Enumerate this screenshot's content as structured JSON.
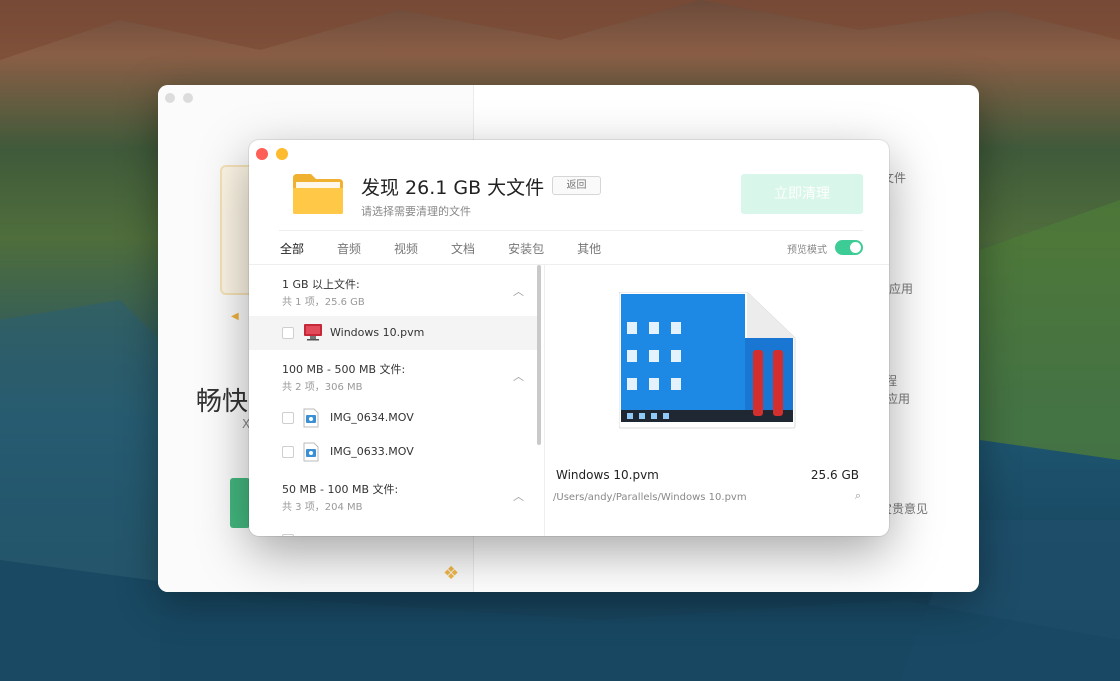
{
  "background_window": {
    "title": "畅快",
    "subtitle": "X",
    "right_texts": [
      "文件",
      "应用",
      "程",
      "应用",
      "宝贵意见"
    ]
  },
  "dialog": {
    "title": "发现 26.1 GB 大文件",
    "subtitle": "请选择需要清理的文件",
    "back_label": "返回",
    "clean_label": "立即清理",
    "tabs": [
      {
        "label": "全部",
        "active": true
      },
      {
        "label": "音频",
        "active": false
      },
      {
        "label": "视频",
        "active": false
      },
      {
        "label": "文档",
        "active": false
      },
      {
        "label": "安装包",
        "active": false
      },
      {
        "label": "其他",
        "active": false
      }
    ],
    "preview_mode_label": "预览模式",
    "preview_mode_on": true,
    "groups": [
      {
        "heading": "1 GB 以上文件:",
        "summary": "共 1 项，25.6 GB",
        "files": [
          {
            "name": "Windows 10.pvm",
            "icon": "parallels-vm-icon",
            "selected": true
          }
        ]
      },
      {
        "heading": "100 MB - 500 MB 文件:",
        "summary": "共 2 项，306 MB",
        "files": [
          {
            "name": "IMG_0634.MOV",
            "icon": "movie-file-icon",
            "selected": false
          },
          {
            "name": "IMG_0633.MOV",
            "icon": "movie-file-icon",
            "selected": false
          }
        ]
      },
      {
        "heading": "50 MB - 100 MB 文件:",
        "summary": "共 3 项，204 MB",
        "files": []
      }
    ],
    "preview": {
      "file_name": "Windows 10.pvm",
      "file_size": "25.6 GB",
      "path": "/Users/andy/Parallels/Windows 10.pvm"
    }
  },
  "colors": {
    "accent_green": "#3dcc95",
    "clean_button_bg": "#d9f6ea",
    "close": "#fe5f57",
    "minimize": "#febb2e"
  }
}
